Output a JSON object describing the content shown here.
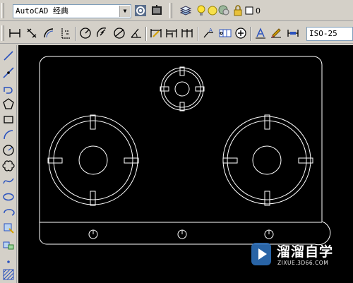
{
  "toolbar": {
    "workspace_value": "AutoCAD 经典",
    "layer_value": "0",
    "dim_style_value": "ISO-25"
  },
  "icons": {
    "row1": [
      "workspace-settings-icon",
      "my-workspace-icon",
      "layer-manager-icon",
      "layer-on-icon",
      "layer-freeze-icon",
      "layer-lock-icon",
      "layer-color-icon"
    ],
    "row2": [
      "linear-dimension-icon",
      "aligned-dimension-icon",
      "arc-length-icon",
      "ordinate-dimension-icon",
      "radius-dimension-icon",
      "jogged-dimension-icon",
      "diameter-dimension-icon",
      "angular-dimension-icon",
      "quick-dimension-icon",
      "baseline-dimension-icon",
      "continue-dimension-icon",
      "quick-leader-icon",
      "tolerance-icon",
      "center-mark-icon",
      "dimension-edit-icon",
      "dimension-text-edit-icon",
      "dimension-update-icon"
    ],
    "left": [
      "line-icon",
      "construction-line-icon",
      "polyline-icon",
      "polygon-icon",
      "rectangle-icon",
      "arc-icon",
      "circle-icon",
      "revision-cloud-icon",
      "spline-icon",
      "ellipse-icon",
      "ellipse-arc-icon",
      "insert-block-icon",
      "make-block-icon",
      "point-icon",
      "hatch-icon"
    ]
  },
  "colors": {
    "canvas_background": "#000000",
    "drawing_lines": "#ffffff",
    "toolbar_background": "#d4d0c8",
    "watermark_logo": "#2d6fb8"
  },
  "watermark": {
    "title": "溜溜自学",
    "subtitle": "ZIXUE.3D66.COM"
  }
}
